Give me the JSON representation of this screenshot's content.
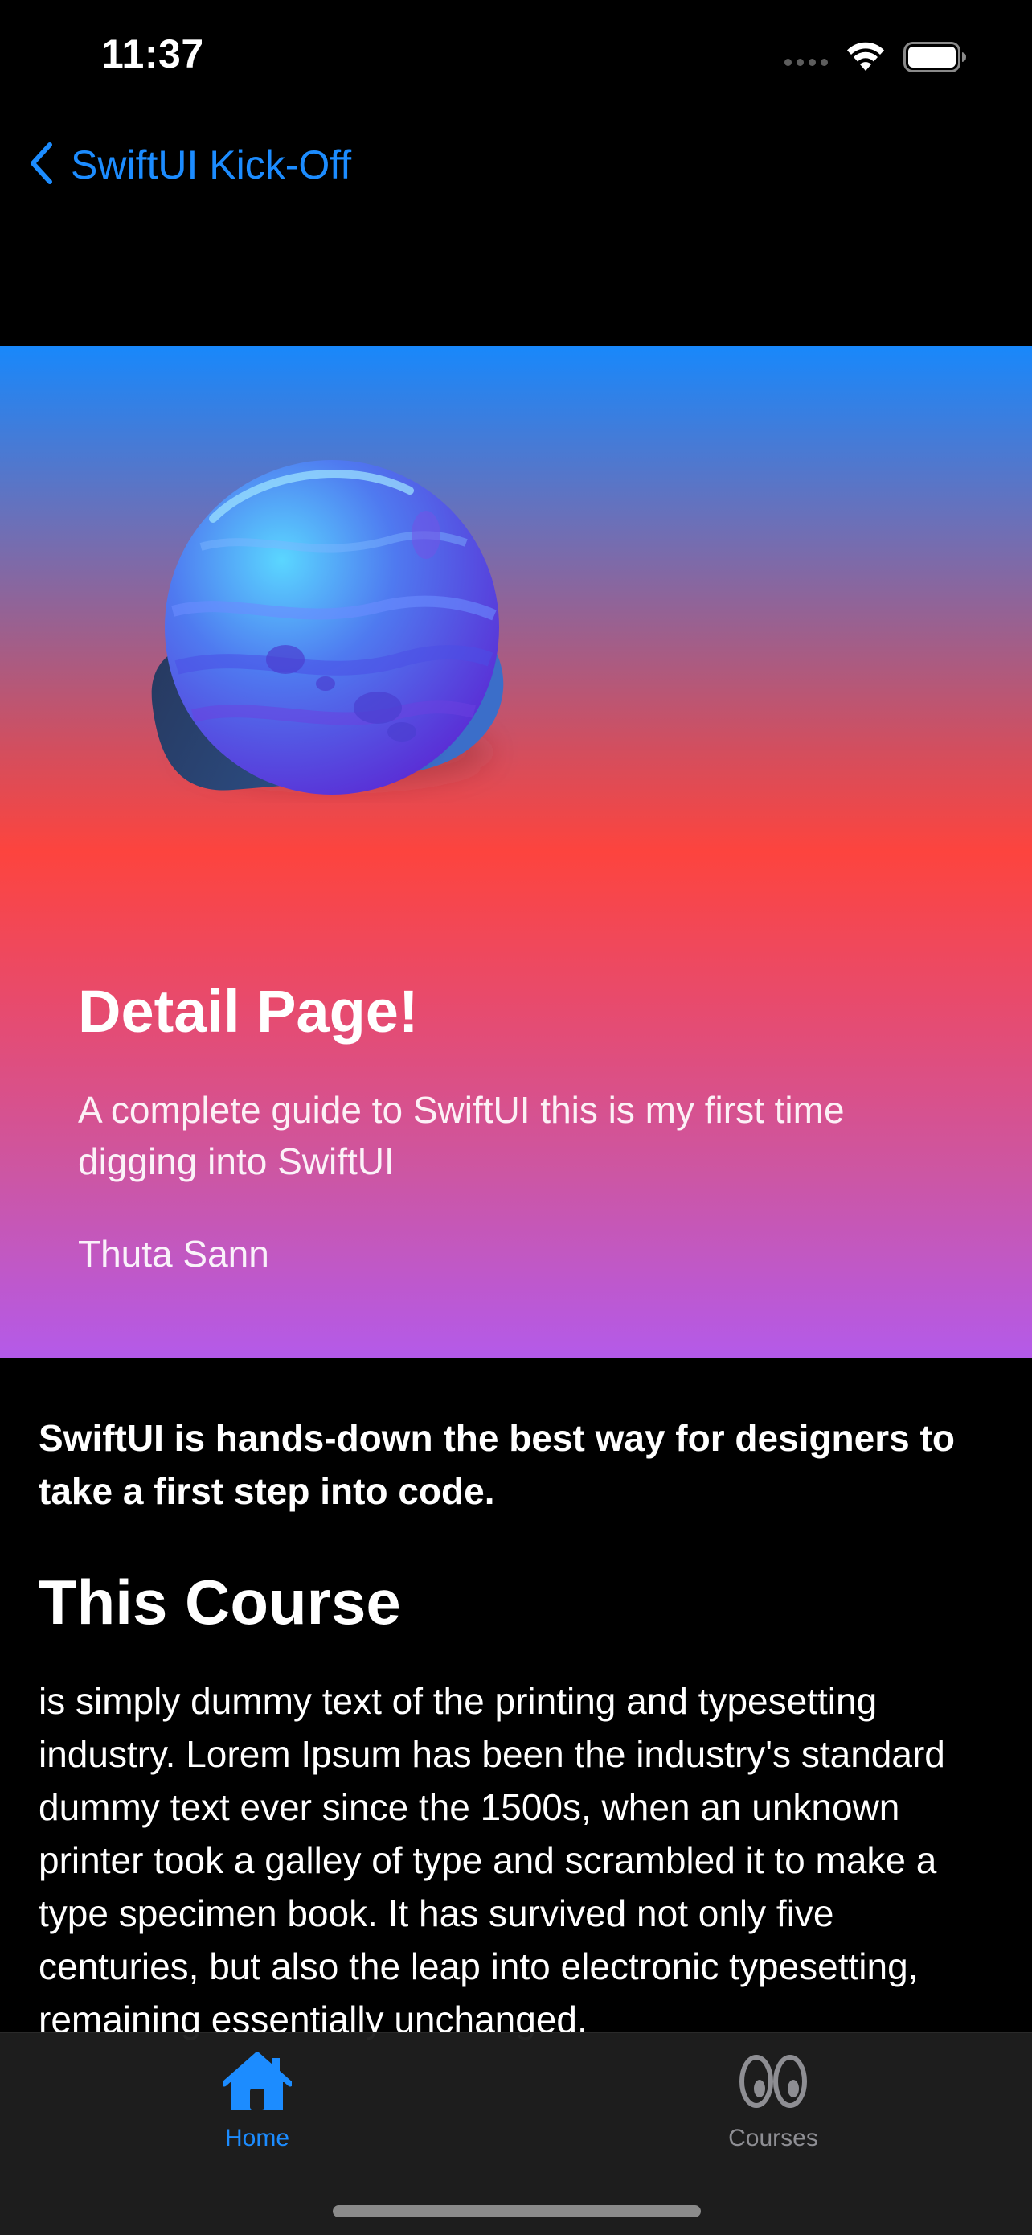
{
  "status_bar": {
    "time": "11:37"
  },
  "nav": {
    "back_label": "SwiftUI Kick-Off"
  },
  "hero": {
    "title": "Detail Page!",
    "subtitle": "A complete guide to SwiftUI this is my first time digging into SwiftUI",
    "author": "Thuta Sann",
    "gradient_colors": [
      "#1888fb",
      "#fd443e",
      "#b45ae9"
    ]
  },
  "content": {
    "intro": "SwiftUI is hands-down the best way for designers to take a first step into code.",
    "section_heading": "This Course",
    "body": "is simply dummy text of the printing and typesetting industry. Lorem Ipsum has been the industry's standard dummy text ever since the 1500s, when an unknown printer took a galley of type and scrambled it to make a type specimen book. It has survived not only five centuries, but also the leap into electronic typesetting, remaining essentially unchanged."
  },
  "tab_bar": {
    "tabs": [
      {
        "label": "Home",
        "icon": "house-icon",
        "selected": true
      },
      {
        "label": "Courses",
        "icon": "eyes-icon",
        "selected": false
      }
    ],
    "accent_color": "#1c8cff",
    "inactive_color": "#8e8e93"
  }
}
